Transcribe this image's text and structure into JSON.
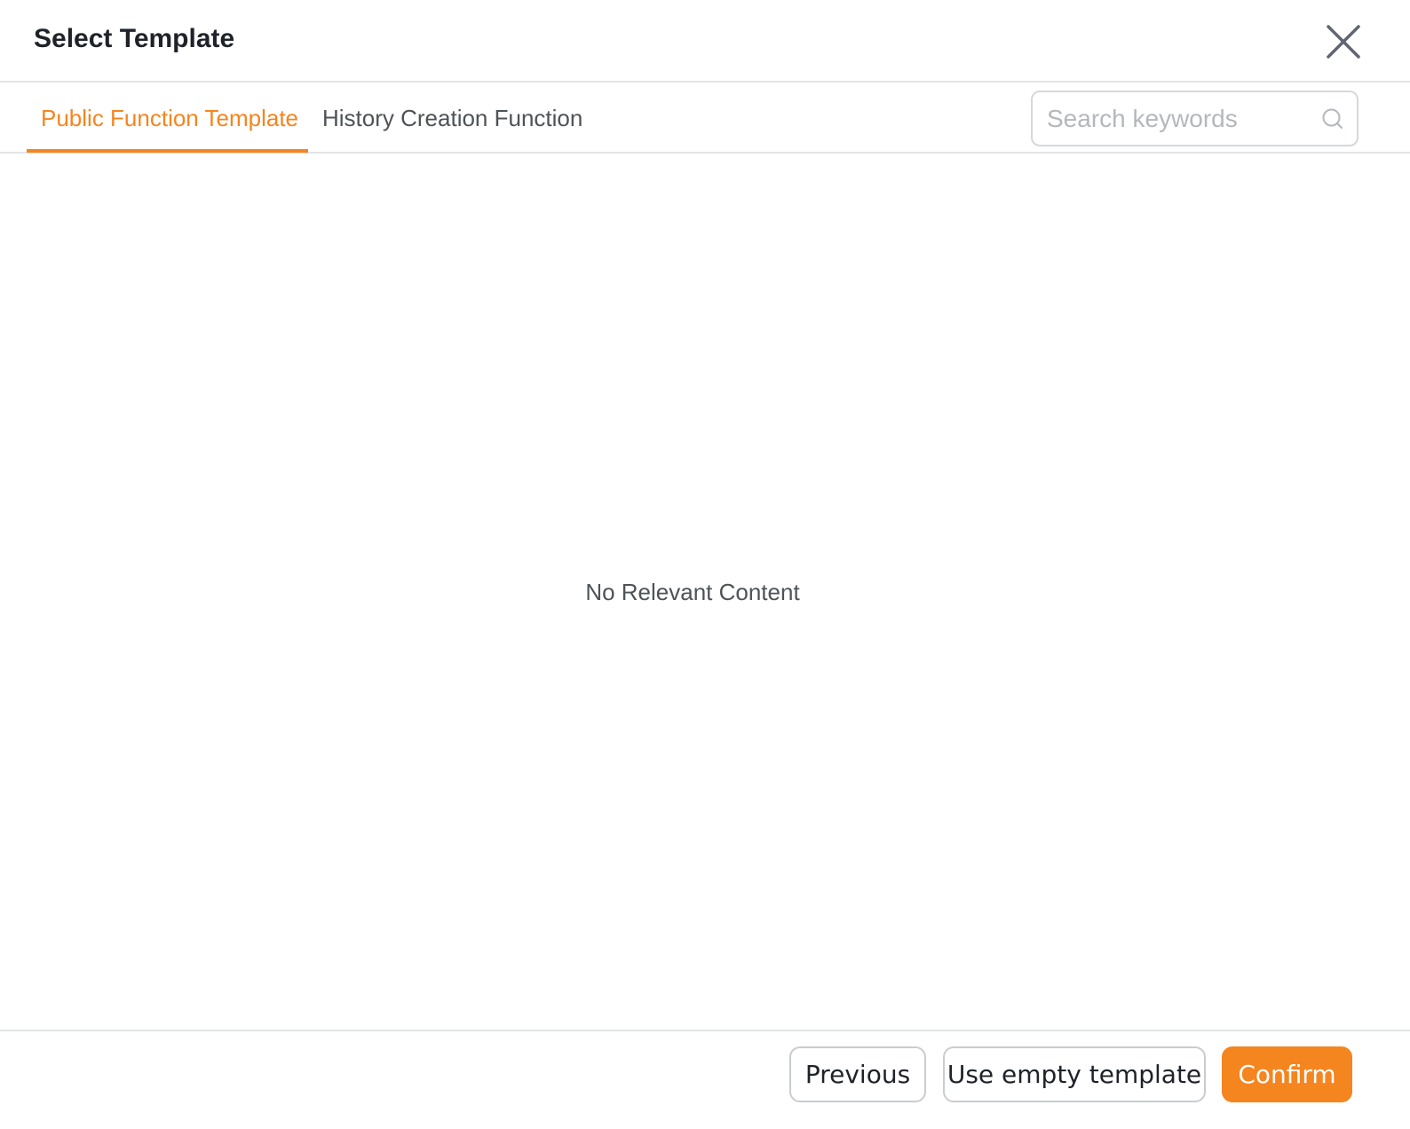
{
  "dialog": {
    "title": "Select Template",
    "close_icon": "close-icon"
  },
  "tabs": [
    {
      "label": "Public Function Template",
      "active": true
    },
    {
      "label": "History Creation Function",
      "active": false
    }
  ],
  "search": {
    "value": "",
    "placeholder": "Search keywords",
    "icon": "search-icon"
  },
  "content": {
    "empty_message": "No Relevant Content"
  },
  "footer": {
    "previous_label": "Previous",
    "empty_template_label": "Use empty template",
    "confirm_label": "Confirm"
  },
  "colors": {
    "accent": "#f5851f",
    "text_primary": "#1f2329",
    "text_secondary": "#4e5358",
    "border": "#e3e5e8"
  }
}
